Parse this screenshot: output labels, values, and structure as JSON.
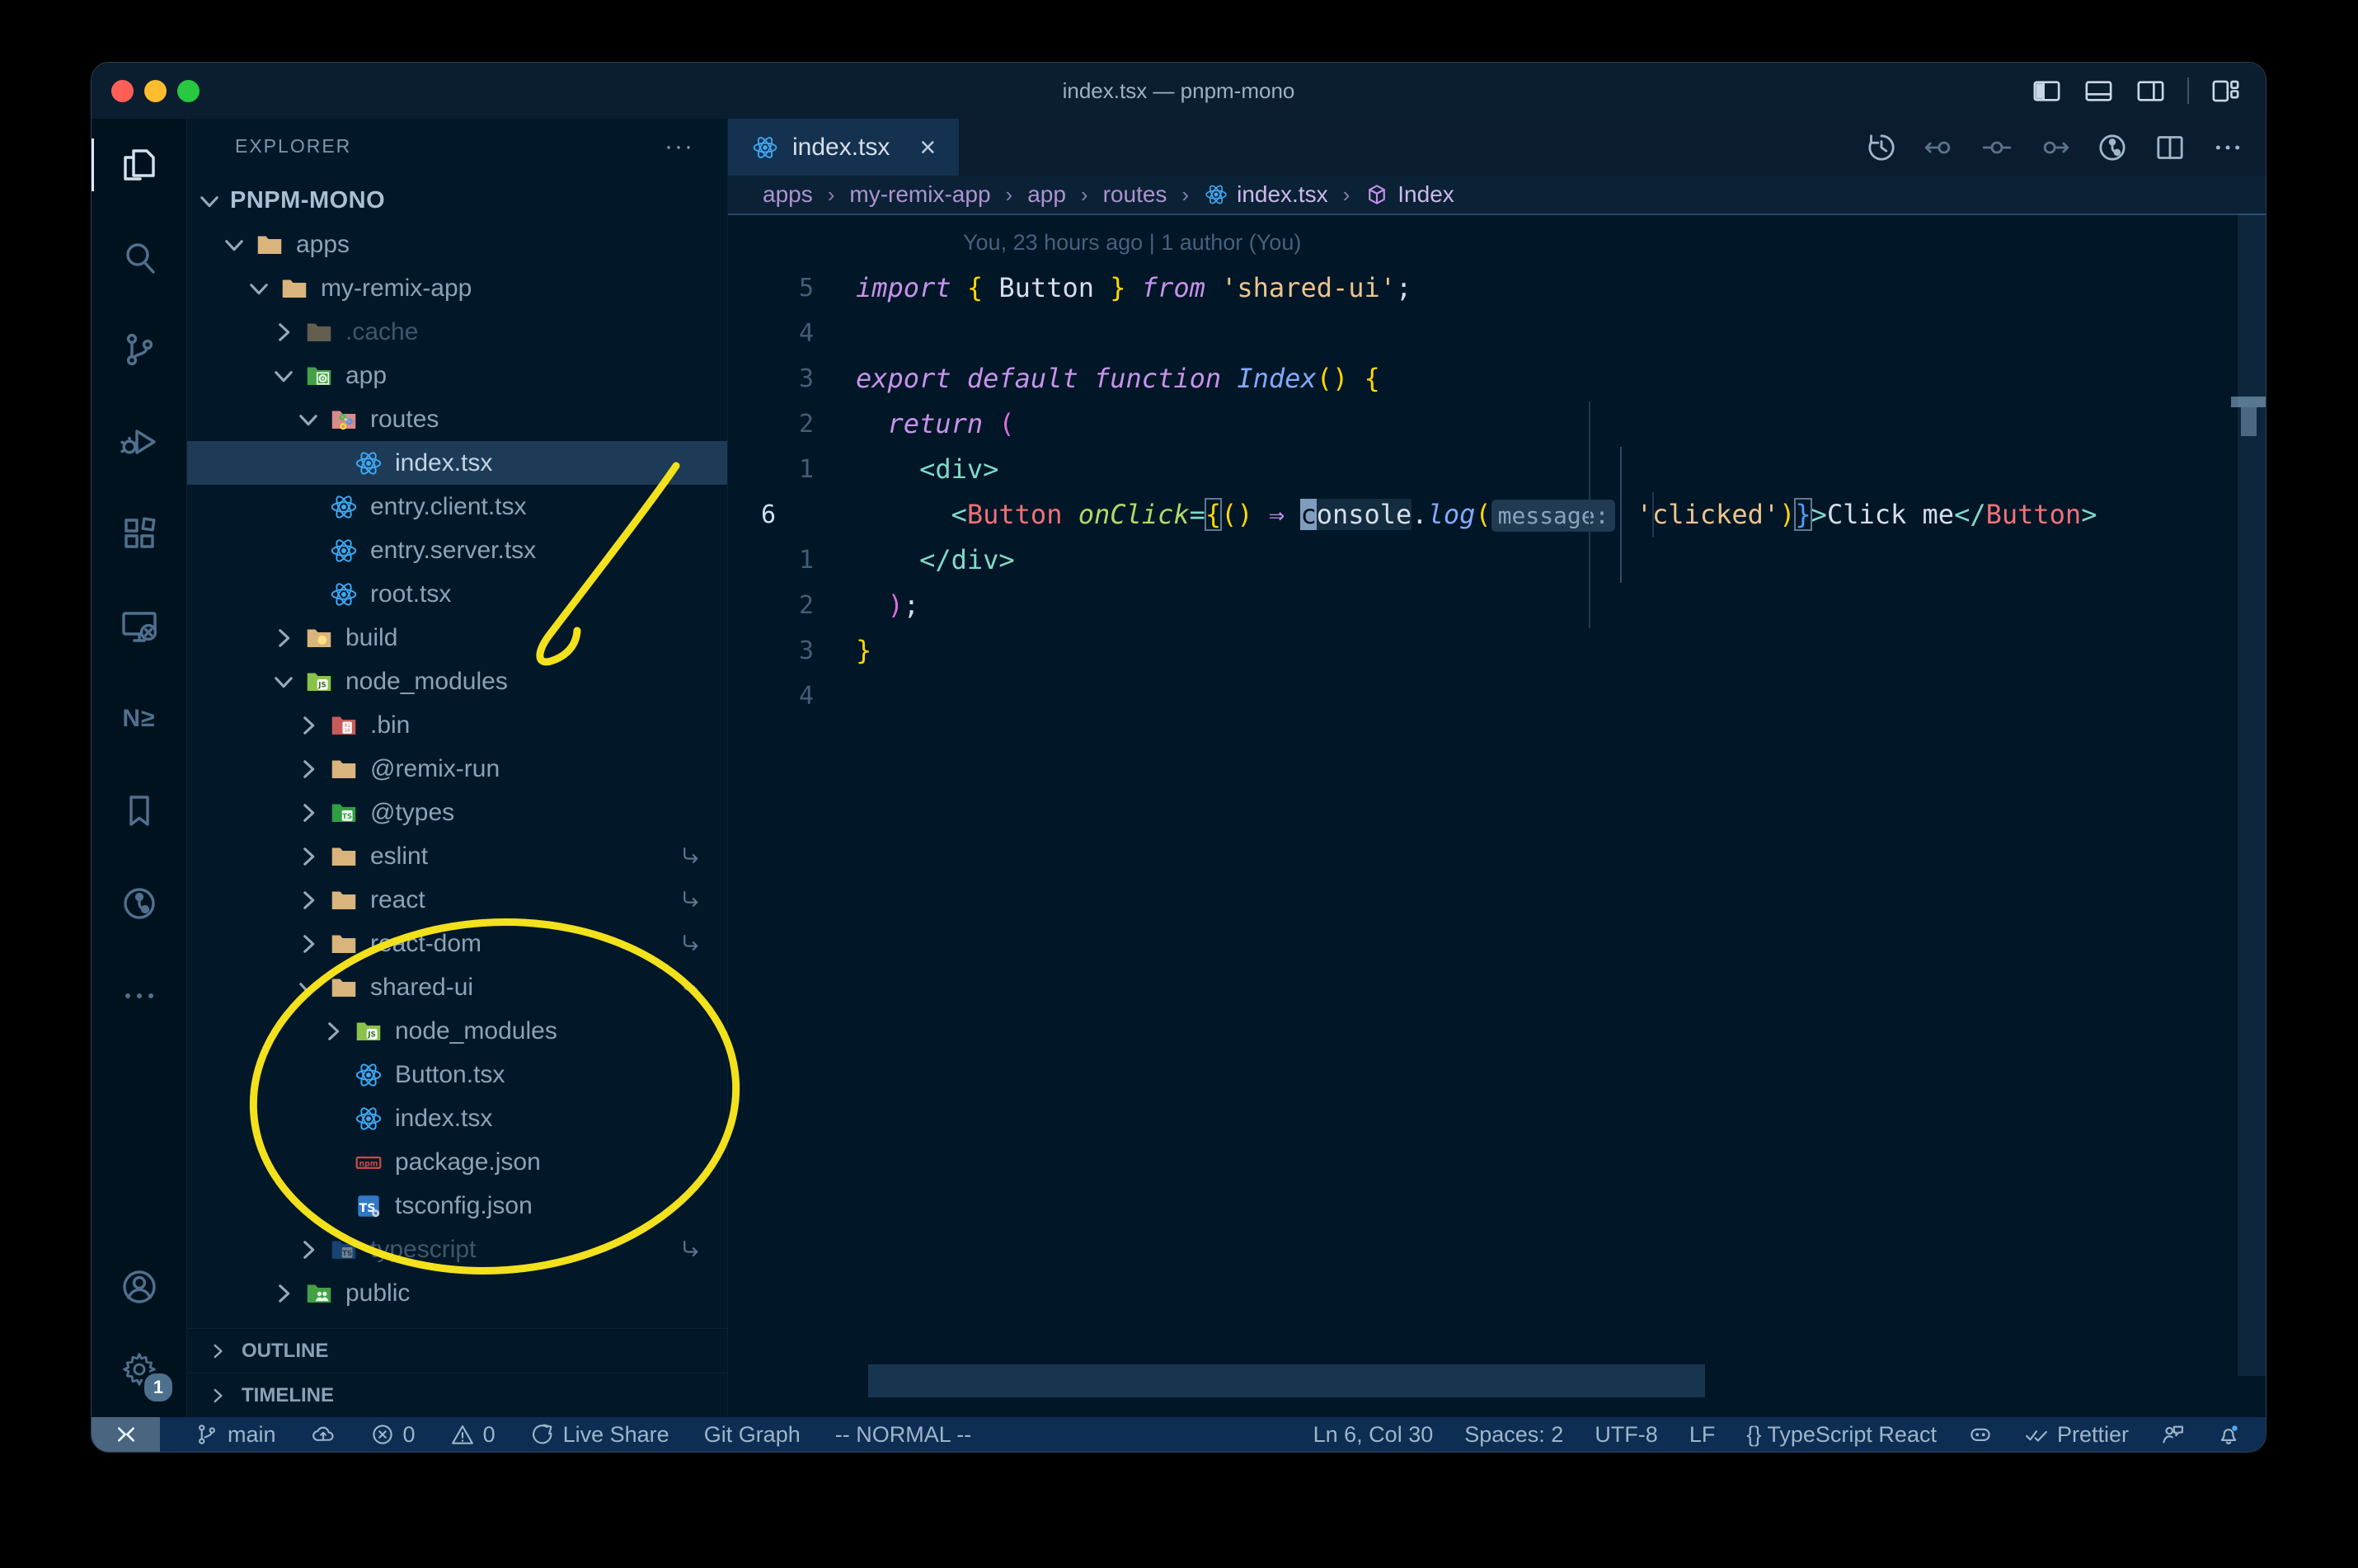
{
  "window": {
    "title": "index.tsx — pnpm-mono"
  },
  "colors": {
    "annotation_yellow": "#f2e11c",
    "traffic_red": "#ff5f57",
    "traffic_yellow": "#febc2e",
    "traffic_green": "#28c840",
    "react_blue": "#3fa9f5",
    "breadcrumb_symbol_purple": "#c792ea",
    "selection_bg": "#1d3a57",
    "status_bg": "#0d2e52"
  },
  "titlebar": {
    "layout_icons": [
      "layout-sidebar-left-icon",
      "layout-panel-icon",
      "layout-sidebar-right-icon",
      "separator",
      "layout-customize-icon"
    ]
  },
  "activity_bar": {
    "top": [
      {
        "name": "explorer",
        "active": true
      },
      {
        "name": "search"
      },
      {
        "name": "source-control"
      },
      {
        "name": "run-debug"
      },
      {
        "name": "extensions"
      },
      {
        "name": "remote-explorer"
      },
      {
        "name": "nx-console",
        "text": "N≥"
      },
      {
        "name": "bookmarks"
      },
      {
        "name": "git-graph"
      },
      {
        "name": "more"
      }
    ],
    "bottom": [
      {
        "name": "account"
      },
      {
        "name": "settings",
        "badge": "1"
      }
    ]
  },
  "sidebar": {
    "header": "EXPLORER",
    "header_menu": "···",
    "sections": [
      "OUTLINE",
      "TIMELINE"
    ],
    "tree": [
      {
        "label": "PNPM-MONO",
        "level": 0,
        "chevron": "open",
        "root": true
      },
      {
        "label": "apps",
        "level": 1,
        "chevron": "open",
        "icon": "folder-tan"
      },
      {
        "label": "my-remix-app",
        "level": 2,
        "chevron": "open",
        "icon": "folder-tan"
      },
      {
        "label": ".cache",
        "level": 3,
        "chevron": "closed",
        "icon": "folder-tan",
        "dim": true
      },
      {
        "label": "app",
        "level": 3,
        "chevron": "open",
        "icon": "folder-app"
      },
      {
        "label": "routes",
        "level": 4,
        "chevron": "open",
        "icon": "folder-routes"
      },
      {
        "label": "index.tsx",
        "level": 5,
        "icon": "react",
        "selected": true
      },
      {
        "label": "entry.client.tsx",
        "level": 4,
        "icon": "react"
      },
      {
        "label": "entry.server.tsx",
        "level": 4,
        "icon": "react"
      },
      {
        "label": "root.tsx",
        "level": 4,
        "icon": "react"
      },
      {
        "label": "build",
        "level": 3,
        "chevron": "closed",
        "icon": "folder-build"
      },
      {
        "label": "node_modules",
        "level": 3,
        "chevron": "open",
        "icon": "folder-node"
      },
      {
        "label": ".bin",
        "level": 4,
        "chevron": "closed",
        "icon": "folder-bin"
      },
      {
        "label": "@remix-run",
        "level": 4,
        "chevron": "closed",
        "icon": "folder-tan"
      },
      {
        "label": "@types",
        "level": 4,
        "chevron": "closed",
        "icon": "folder-types"
      },
      {
        "label": "eslint",
        "level": 4,
        "chevron": "closed",
        "icon": "folder-tan",
        "symlink": true
      },
      {
        "label": "react",
        "level": 4,
        "chevron": "closed",
        "icon": "folder-tan",
        "symlink": true
      },
      {
        "label": "react-dom",
        "level": 4,
        "chevron": "closed",
        "icon": "folder-tan",
        "symlink": true
      },
      {
        "label": "shared-ui",
        "level": 4,
        "chevron": "open",
        "icon": "folder-tan",
        "symlink": true
      },
      {
        "label": "node_modules",
        "level": 5,
        "chevron": "closed",
        "icon": "folder-node"
      },
      {
        "label": "Button.tsx",
        "level": 5,
        "icon": "react"
      },
      {
        "label": "index.tsx",
        "level": 5,
        "icon": "react"
      },
      {
        "label": "package.json",
        "level": 5,
        "icon": "npm"
      },
      {
        "label": "tsconfig.json",
        "level": 5,
        "icon": "tsconfig"
      },
      {
        "label": "typescript",
        "level": 4,
        "chevron": "closed",
        "icon": "folder-ts",
        "dim": true,
        "symlink": true
      },
      {
        "label": "public",
        "level": 3,
        "chevron": "closed",
        "icon": "folder-public"
      }
    ]
  },
  "tabs": [
    {
      "label": "index.tsx",
      "icon": "react",
      "close": "×",
      "active": true
    }
  ],
  "editor_actions": [
    {
      "name": "history-icon"
    },
    {
      "name": "commit-back-icon",
      "dim": true
    },
    {
      "name": "commit-icon",
      "dim": true
    },
    {
      "name": "commit-forward-icon",
      "dim": true
    },
    {
      "name": "git-graph-icon"
    },
    {
      "name": "split-editor-icon"
    },
    {
      "name": "more-icon"
    }
  ],
  "breadcrumbs": [
    {
      "label": "apps"
    },
    {
      "label": "my-remix-app"
    },
    {
      "label": "app"
    },
    {
      "label": "routes"
    },
    {
      "label": "index.tsx",
      "icon": "react",
      "bright": true
    },
    {
      "label": "Index",
      "icon": "symbol-cube",
      "bright": true
    }
  ],
  "editor": {
    "gitlens_annotation": "You, 23 hours ago | 1 author (You)",
    "lines": [
      {
        "lens": true
      },
      {
        "gutter": "5",
        "tokens": [
          [
            "kw",
            "import "
          ],
          [
            "b1",
            "{"
          ],
          [
            "fg",
            " Button "
          ],
          [
            "b1",
            "}"
          ],
          [
            "kw",
            " from "
          ],
          [
            "str",
            "'shared-ui'"
          ],
          [
            "fg",
            ";"
          ]
        ]
      },
      {
        "gutter": "4",
        "tokens": []
      },
      {
        "gutter": "3",
        "tokens": [
          [
            "kw",
            "export "
          ],
          [
            "kw",
            "default "
          ],
          [
            "kw",
            "function "
          ],
          [
            "fn",
            "Index"
          ],
          [
            "b1",
            "()"
          ],
          [
            "fg",
            " "
          ],
          [
            "b1",
            "{"
          ]
        ]
      },
      {
        "gutter": "2",
        "tokens": [
          [
            "fg",
            "  "
          ],
          [
            "kw",
            "return "
          ],
          [
            "b2",
            "("
          ]
        ]
      },
      {
        "gutter": "1",
        "tokens": [
          [
            "fg",
            "    "
          ],
          [
            "tag",
            "<div>"
          ]
        ]
      },
      {
        "gutter": "6",
        "active": true,
        "tokens": [
          [
            "fg",
            "      "
          ],
          [
            "tag",
            "<"
          ],
          [
            "cmp",
            "Button"
          ],
          [
            "fg",
            " "
          ],
          [
            "attr",
            "onClick"
          ],
          [
            "tag",
            "="
          ],
          [
            "b1m",
            "{"
          ],
          [
            "b1",
            "()"
          ],
          [
            "fg",
            " "
          ],
          [
            "kw",
            "⇒"
          ],
          [
            "fg",
            " "
          ],
          [
            "cur",
            "c"
          ],
          [
            "whl",
            "onsole"
          ],
          [
            "fg",
            "."
          ],
          [
            "fn",
            "log"
          ],
          [
            "b1",
            "("
          ],
          [
            "inlay",
            "message:"
          ],
          [
            "fg",
            " "
          ],
          [
            "str",
            "'clicked'"
          ],
          [
            "b1",
            ")"
          ],
          [
            "b3m",
            "}"
          ],
          [
            "tag",
            ">"
          ],
          [
            "fg",
            "Click me"
          ],
          [
            "tag",
            "</"
          ],
          [
            "cmp",
            "Button"
          ],
          [
            "tag",
            ">"
          ]
        ]
      },
      {
        "gutter": "1",
        "tokens": [
          [
            "fg",
            "    "
          ],
          [
            "tag",
            "</div>"
          ]
        ]
      },
      {
        "gutter": "2",
        "tokens": [
          [
            "fg",
            "  "
          ],
          [
            "b2",
            ")"
          ],
          [
            "fg",
            ";"
          ]
        ]
      },
      {
        "gutter": "3",
        "tokens": [
          [
            "b1",
            "}"
          ]
        ]
      },
      {
        "gutter": "4",
        "tokens": []
      }
    ]
  },
  "status_bar": {
    "left": [
      {
        "name": "remote-indicator",
        "icon": "remote-icon",
        "remote": true
      },
      {
        "name": "git-branch",
        "icon": "branch-icon",
        "label": "main"
      },
      {
        "name": "sync-publish",
        "icon": "cloud-upload-icon"
      },
      {
        "name": "errors",
        "icon": "error-icon",
        "label": "0"
      },
      {
        "name": "warnings",
        "icon": "warning-icon",
        "label": "0"
      },
      {
        "name": "live-share",
        "icon": "live-share-icon",
        "label": "Live Share"
      },
      {
        "name": "git-graph",
        "label": "Git Graph"
      },
      {
        "name": "vim-mode",
        "label": "-- NORMAL --"
      }
    ],
    "right": [
      {
        "name": "cursor-position",
        "label": "Ln 6, Col 30"
      },
      {
        "name": "indentation",
        "label": "Spaces: 2"
      },
      {
        "name": "encoding",
        "label": "UTF-8"
      },
      {
        "name": "eol",
        "label": "LF"
      },
      {
        "name": "language-mode",
        "label": "{} TypeScript React"
      },
      {
        "name": "copilot",
        "icon": "copilot-icon"
      },
      {
        "name": "prettier",
        "icon": "prettier-checks-icon",
        "label": "Prettier"
      },
      {
        "name": "feedback",
        "icon": "feedback-icon"
      },
      {
        "name": "notifications",
        "icon": "bell-icon"
      }
    ]
  }
}
